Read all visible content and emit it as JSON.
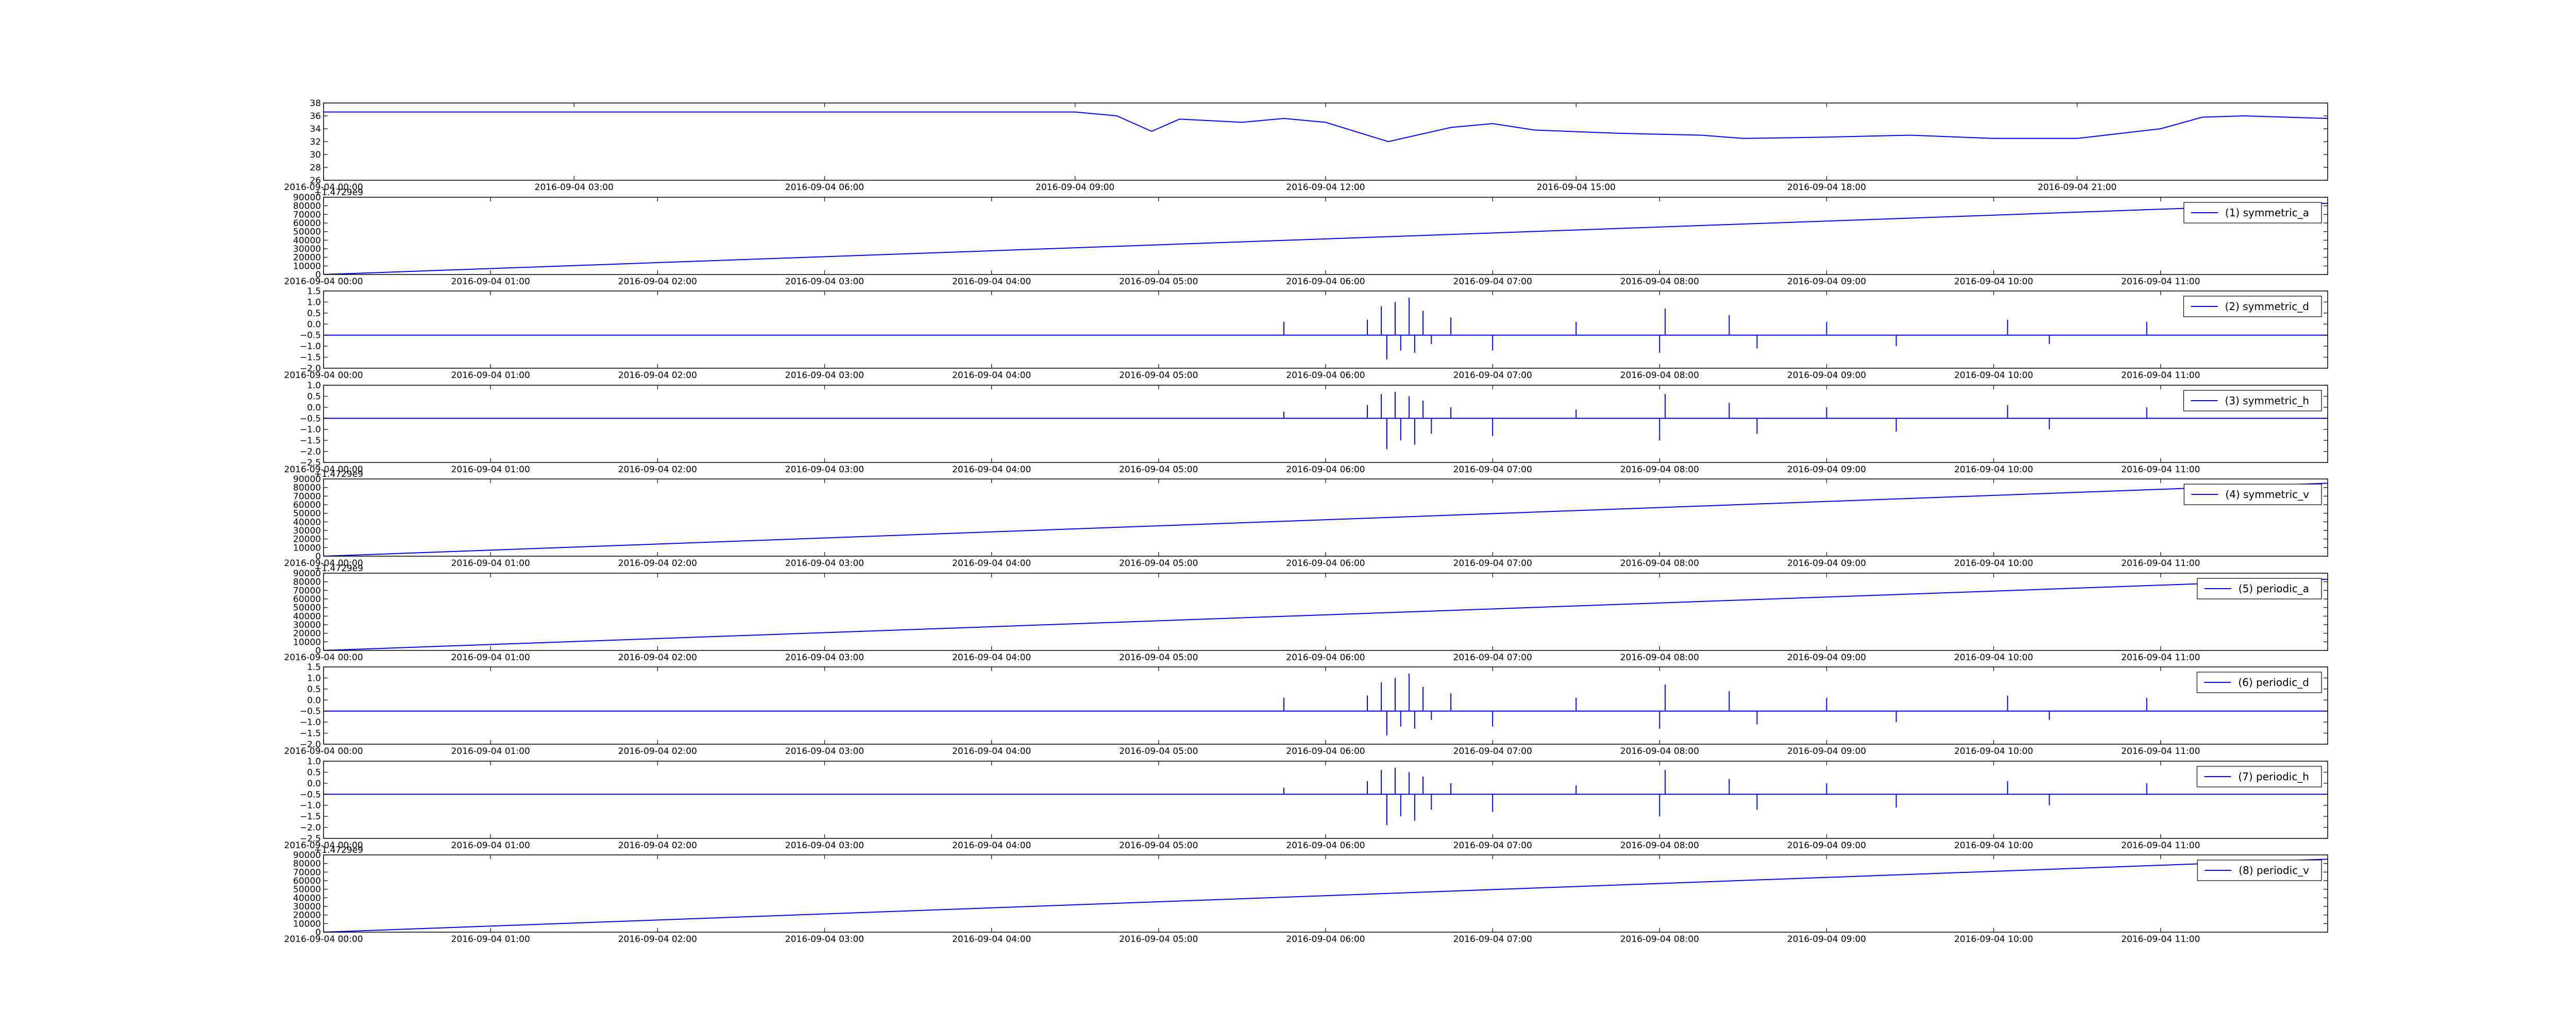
{
  "colors": {
    "line": "#0000ff",
    "axes": "#000000",
    "background": "#ffffff"
  },
  "chart_data": [
    {
      "type": "line",
      "legend": null,
      "legend_position": null,
      "grid": false,
      "x_axis": {
        "type": "datetime",
        "range": [
          "2016-09-04 00:00",
          "2016-09-05 00:00"
        ],
        "ticks": [
          "2016-09-04 00:00",
          "2016-09-04 03:00",
          "2016-09-04 06:00",
          "2016-09-04 09:00",
          "2016-09-04 12:00",
          "2016-09-04 15:00",
          "2016-09-04 18:00",
          "2016-09-04 21:00"
        ]
      },
      "y_axis": {
        "range": [
          26,
          38
        ],
        "ticks": [
          "26",
          "28",
          "30",
          "32",
          "34",
          "36",
          "38"
        ],
        "offset_label": ""
      },
      "series": [
        {
          "points": [
            [
              "2016-09-04 00:00",
              36.6
            ],
            [
              "2016-09-04 09:00",
              36.6
            ],
            [
              "2016-09-04 09:30",
              36.0
            ],
            [
              "2016-09-04 09:55",
              33.6
            ],
            [
              "2016-09-04 10:15",
              35.5
            ],
            [
              "2016-09-04 11:00",
              35.0
            ],
            [
              "2016-09-04 11:30",
              35.6
            ],
            [
              "2016-09-04 12:00",
              35.0
            ],
            [
              "2016-09-04 12:45",
              32.0
            ],
            [
              "2016-09-04 13:30",
              34.2
            ],
            [
              "2016-09-04 14:00",
              34.8
            ],
            [
              "2016-09-04 14:30",
              33.8
            ],
            [
              "2016-09-04 15:30",
              33.3
            ],
            [
              "2016-09-04 16:30",
              33.0
            ],
            [
              "2016-09-04 17:00",
              32.5
            ],
            [
              "2016-09-04 18:00",
              32.7
            ],
            [
              "2016-09-04 19:00",
              33.0
            ],
            [
              "2016-09-04 20:00",
              32.5
            ],
            [
              "2016-09-04 21:00",
              32.5
            ],
            [
              "2016-09-04 22:00",
              34.0
            ],
            [
              "2016-09-04 22:30",
              35.8
            ],
            [
              "2016-09-04 23:00",
              36.0
            ],
            [
              "2016-09-05 00:00",
              35.6
            ]
          ]
        }
      ]
    },
    {
      "type": "line",
      "legend": "(1) symmetric_a",
      "legend_position": "top-right",
      "grid": false,
      "x_axis": {
        "type": "datetime",
        "range": [
          "2016-09-04 00:00",
          "2016-09-04 12:00"
        ],
        "ticks": [
          "2016-09-04 00:00",
          "2016-09-04 01:00",
          "2016-09-04 02:00",
          "2016-09-04 03:00",
          "2016-09-04 04:00",
          "2016-09-04 05:00",
          "2016-09-04 06:00",
          "2016-09-04 07:00",
          "2016-09-04 08:00",
          "2016-09-04 09:00",
          "2016-09-04 10:00",
          "2016-09-04 11:00"
        ]
      },
      "y_axis": {
        "range": [
          0,
          90000
        ],
        "ticks": [
          "0",
          "10000",
          "20000",
          "30000",
          "40000",
          "50000",
          "60000",
          "70000",
          "80000",
          "90000"
        ],
        "offset_label": "+1.4729e9"
      },
      "series": [
        {
          "points": [
            [
              "2016-09-04 00:00",
              0
            ],
            [
              "2016-09-04 12:00",
              83000
            ]
          ]
        }
      ]
    },
    {
      "type": "line",
      "legend": "(2) symmetric_d",
      "legend_position": "top-right",
      "grid": false,
      "x_axis": {
        "type": "datetime",
        "range": [
          "2016-09-04 00:00",
          "2016-09-04 12:00"
        ],
        "ticks": [
          "2016-09-04 00:00",
          "2016-09-04 01:00",
          "2016-09-04 02:00",
          "2016-09-04 03:00",
          "2016-09-04 04:00",
          "2016-09-04 05:00",
          "2016-09-04 06:00",
          "2016-09-04 07:00",
          "2016-09-04 08:00",
          "2016-09-04 09:00",
          "2016-09-04 10:00",
          "2016-09-04 11:00"
        ]
      },
      "y_axis": {
        "range": [
          -2.0,
          1.5
        ],
        "ticks": [
          "−2.0",
          "−1.5",
          "−1.0",
          "−0.5",
          "0.0",
          "0.5",
          "1.0",
          "1.5"
        ],
        "offset_label": ""
      },
      "series": [
        {
          "baseline": -0.5,
          "spikes": [
            [
              "2016-09-04 05:45",
              0.1
            ],
            [
              "2016-09-04 06:15",
              0.2
            ],
            [
              "2016-09-04 06:20",
              0.8
            ],
            [
              "2016-09-04 06:22",
              -1.6
            ],
            [
              "2016-09-04 06:25",
              1.0
            ],
            [
              "2016-09-04 06:27",
              -1.2
            ],
            [
              "2016-09-04 06:30",
              1.2
            ],
            [
              "2016-09-04 06:32",
              -1.3
            ],
            [
              "2016-09-04 06:35",
              0.6
            ],
            [
              "2016-09-04 06:38",
              -0.9
            ],
            [
              "2016-09-04 06:45",
              0.3
            ],
            [
              "2016-09-04 07:00",
              -1.2
            ],
            [
              "2016-09-04 07:30",
              0.1
            ],
            [
              "2016-09-04 08:00",
              -1.3
            ],
            [
              "2016-09-04 08:02",
              0.7
            ],
            [
              "2016-09-04 08:25",
              0.4
            ],
            [
              "2016-09-04 08:35",
              -1.1
            ],
            [
              "2016-09-04 09:00",
              0.1
            ],
            [
              "2016-09-04 09:25",
              -1.0
            ],
            [
              "2016-09-04 10:05",
              0.2
            ],
            [
              "2016-09-04 10:20",
              -0.9
            ],
            [
              "2016-09-04 10:55",
              0.1
            ]
          ]
        }
      ]
    },
    {
      "type": "line",
      "legend": "(3) symmetric_h",
      "legend_position": "top-right",
      "grid": false,
      "x_axis": {
        "type": "datetime",
        "range": [
          "2016-09-04 00:00",
          "2016-09-04 12:00"
        ],
        "ticks": [
          "2016-09-04 00:00",
          "2016-09-04 01:00",
          "2016-09-04 02:00",
          "2016-09-04 03:00",
          "2016-09-04 04:00",
          "2016-09-04 05:00",
          "2016-09-04 06:00",
          "2016-09-04 07:00",
          "2016-09-04 08:00",
          "2016-09-04 09:00",
          "2016-09-04 10:00",
          "2016-09-04 11:00"
        ]
      },
      "y_axis": {
        "range": [
          -2.5,
          1.0
        ],
        "ticks": [
          "−2.5",
          "−2.0",
          "−1.5",
          "−1.0",
          "−0.5",
          "0.0",
          "0.5",
          "1.0"
        ],
        "offset_label": ""
      },
      "series": [
        {
          "baseline": -0.5,
          "spikes": [
            [
              "2016-09-04 05:45",
              -0.2
            ],
            [
              "2016-09-04 06:15",
              0.1
            ],
            [
              "2016-09-04 06:20",
              0.6
            ],
            [
              "2016-09-04 06:22",
              -1.9
            ],
            [
              "2016-09-04 06:25",
              0.7
            ],
            [
              "2016-09-04 06:27",
              -1.5
            ],
            [
              "2016-09-04 06:30",
              0.5
            ],
            [
              "2016-09-04 06:32",
              -1.7
            ],
            [
              "2016-09-04 06:35",
              0.3
            ],
            [
              "2016-09-04 06:38",
              -1.2
            ],
            [
              "2016-09-04 06:45",
              0.0
            ],
            [
              "2016-09-04 07:00",
              -1.3
            ],
            [
              "2016-09-04 07:30",
              -0.1
            ],
            [
              "2016-09-04 08:00",
              -1.5
            ],
            [
              "2016-09-04 08:02",
              0.6
            ],
            [
              "2016-09-04 08:25",
              0.2
            ],
            [
              "2016-09-04 08:35",
              -1.2
            ],
            [
              "2016-09-04 09:00",
              0.0
            ],
            [
              "2016-09-04 09:25",
              -1.1
            ],
            [
              "2016-09-04 10:05",
              0.1
            ],
            [
              "2016-09-04 10:20",
              -1.0
            ],
            [
              "2016-09-04 10:55",
              0.0
            ]
          ]
        }
      ]
    },
    {
      "type": "line",
      "legend": "(4) symmetric_v",
      "legend_position": "top-right",
      "grid": false,
      "x_axis": {
        "type": "datetime",
        "range": [
          "2016-09-04 00:00",
          "2016-09-04 12:00"
        ],
        "ticks": [
          "2016-09-04 00:00",
          "2016-09-04 01:00",
          "2016-09-04 02:00",
          "2016-09-04 03:00",
          "2016-09-04 04:00",
          "2016-09-04 05:00",
          "2016-09-04 06:00",
          "2016-09-04 07:00",
          "2016-09-04 08:00",
          "2016-09-04 09:00",
          "2016-09-04 10:00",
          "2016-09-04 11:00"
        ]
      },
      "y_axis": {
        "range": [
          0,
          90000
        ],
        "ticks": [
          "0",
          "10000",
          "20000",
          "30000",
          "40000",
          "50000",
          "60000",
          "70000",
          "80000",
          "90000"
        ],
        "offset_label": "+1.4729e9"
      },
      "series": [
        {
          "points": [
            [
              "2016-09-04 00:00",
              0
            ],
            [
              "2016-09-04 12:00",
              85000
            ]
          ]
        }
      ]
    },
    {
      "type": "line",
      "legend": "(5) periodic_a",
      "legend_position": "top-right",
      "grid": false,
      "x_axis": {
        "type": "datetime",
        "range": [
          "2016-09-04 00:00",
          "2016-09-04 12:00"
        ],
        "ticks": [
          "2016-09-04 00:00",
          "2016-09-04 01:00",
          "2016-09-04 02:00",
          "2016-09-04 03:00",
          "2016-09-04 04:00",
          "2016-09-04 05:00",
          "2016-09-04 06:00",
          "2016-09-04 07:00",
          "2016-09-04 08:00",
          "2016-09-04 09:00",
          "2016-09-04 10:00",
          "2016-09-04 11:00"
        ]
      },
      "y_axis": {
        "range": [
          0,
          90000
        ],
        "ticks": [
          "0",
          "10000",
          "20000",
          "30000",
          "40000",
          "50000",
          "60000",
          "70000",
          "80000",
          "90000"
        ],
        "offset_label": "+1.4729e9"
      },
      "series": [
        {
          "points": [
            [
              "2016-09-04 00:00",
              0
            ],
            [
              "2016-09-04 12:00",
              83000
            ]
          ]
        }
      ]
    },
    {
      "type": "line",
      "legend": "(6) periodic_d",
      "legend_position": "top-right",
      "grid": false,
      "x_axis": {
        "type": "datetime",
        "range": [
          "2016-09-04 00:00",
          "2016-09-04 12:00"
        ],
        "ticks": [
          "2016-09-04 00:00",
          "2016-09-04 01:00",
          "2016-09-04 02:00",
          "2016-09-04 03:00",
          "2016-09-04 04:00",
          "2016-09-04 05:00",
          "2016-09-04 06:00",
          "2016-09-04 07:00",
          "2016-09-04 08:00",
          "2016-09-04 09:00",
          "2016-09-04 10:00",
          "2016-09-04 11:00"
        ]
      },
      "y_axis": {
        "range": [
          -2.0,
          1.5
        ],
        "ticks": [
          "−2.0",
          "−1.5",
          "−1.0",
          "−0.5",
          "0.0",
          "0.5",
          "1.0",
          "1.5"
        ],
        "offset_label": ""
      },
      "series": [
        {
          "baseline": -0.5,
          "spikes": [
            [
              "2016-09-04 05:45",
              0.1
            ],
            [
              "2016-09-04 06:15",
              0.2
            ],
            [
              "2016-09-04 06:20",
              0.8
            ],
            [
              "2016-09-04 06:22",
              -1.6
            ],
            [
              "2016-09-04 06:25",
              1.0
            ],
            [
              "2016-09-04 06:27",
              -1.2
            ],
            [
              "2016-09-04 06:30",
              1.2
            ],
            [
              "2016-09-04 06:32",
              -1.3
            ],
            [
              "2016-09-04 06:35",
              0.6
            ],
            [
              "2016-09-04 06:38",
              -0.9
            ],
            [
              "2016-09-04 06:45",
              0.3
            ],
            [
              "2016-09-04 07:00",
              -1.2
            ],
            [
              "2016-09-04 07:30",
              0.1
            ],
            [
              "2016-09-04 08:00",
              -1.3
            ],
            [
              "2016-09-04 08:02",
              0.7
            ],
            [
              "2016-09-04 08:25",
              0.4
            ],
            [
              "2016-09-04 08:35",
              -1.1
            ],
            [
              "2016-09-04 09:00",
              0.1
            ],
            [
              "2016-09-04 09:25",
              -1.0
            ],
            [
              "2016-09-04 10:05",
              0.2
            ],
            [
              "2016-09-04 10:20",
              -0.9
            ],
            [
              "2016-09-04 10:55",
              0.1
            ]
          ]
        }
      ]
    },
    {
      "type": "line",
      "legend": "(7) periodic_h",
      "legend_position": "top-right",
      "grid": false,
      "x_axis": {
        "type": "datetime",
        "range": [
          "2016-09-04 00:00",
          "2016-09-04 12:00"
        ],
        "ticks": [
          "2016-09-04 00:00",
          "2016-09-04 01:00",
          "2016-09-04 02:00",
          "2016-09-04 03:00",
          "2016-09-04 04:00",
          "2016-09-04 05:00",
          "2016-09-04 06:00",
          "2016-09-04 07:00",
          "2016-09-04 08:00",
          "2016-09-04 09:00",
          "2016-09-04 10:00",
          "2016-09-04 11:00"
        ]
      },
      "y_axis": {
        "range": [
          -2.5,
          1.0
        ],
        "ticks": [
          "−2.5",
          "−2.0",
          "−1.5",
          "−1.0",
          "−0.5",
          "0.0",
          "0.5",
          "1.0"
        ],
        "offset_label": ""
      },
      "series": [
        {
          "baseline": -0.5,
          "spikes": [
            [
              "2016-09-04 05:45",
              -0.2
            ],
            [
              "2016-09-04 06:15",
              0.1
            ],
            [
              "2016-09-04 06:20",
              0.6
            ],
            [
              "2016-09-04 06:22",
              -1.9
            ],
            [
              "2016-09-04 06:25",
              0.7
            ],
            [
              "2016-09-04 06:27",
              -1.5
            ],
            [
              "2016-09-04 06:30",
              0.5
            ],
            [
              "2016-09-04 06:32",
              -1.7
            ],
            [
              "2016-09-04 06:35",
              0.3
            ],
            [
              "2016-09-04 06:38",
              -1.2
            ],
            [
              "2016-09-04 06:45",
              0.0
            ],
            [
              "2016-09-04 07:00",
              -1.3
            ],
            [
              "2016-09-04 07:30",
              -0.1
            ],
            [
              "2016-09-04 08:00",
              -1.5
            ],
            [
              "2016-09-04 08:02",
              0.6
            ],
            [
              "2016-09-04 08:25",
              0.2
            ],
            [
              "2016-09-04 08:35",
              -1.2
            ],
            [
              "2016-09-04 09:00",
              0.0
            ],
            [
              "2016-09-04 09:25",
              -1.1
            ],
            [
              "2016-09-04 10:05",
              0.1
            ],
            [
              "2016-09-04 10:20",
              -1.0
            ],
            [
              "2016-09-04 10:55",
              0.0
            ]
          ]
        }
      ]
    },
    {
      "type": "line",
      "legend": "(8) periodic_v",
      "legend_position": "top-right",
      "grid": false,
      "x_axis": {
        "type": "datetime",
        "range": [
          "2016-09-04 00:00",
          "2016-09-04 12:00"
        ],
        "ticks": [
          "2016-09-04 00:00",
          "2016-09-04 01:00",
          "2016-09-04 02:00",
          "2016-09-04 03:00",
          "2016-09-04 04:00",
          "2016-09-04 05:00",
          "2016-09-04 06:00",
          "2016-09-04 07:00",
          "2016-09-04 08:00",
          "2016-09-04 09:00",
          "2016-09-04 10:00",
          "2016-09-04 11:00"
        ]
      },
      "y_axis": {
        "range": [
          0,
          90000
        ],
        "ticks": [
          "0",
          "10000",
          "20000",
          "30000",
          "40000",
          "50000",
          "60000",
          "70000",
          "80000",
          "90000"
        ],
        "offset_label": "+1.4729e9"
      },
      "series": [
        {
          "points": [
            [
              "2016-09-04 00:00",
              0
            ],
            [
              "2016-09-04 12:00",
              85000
            ]
          ]
        }
      ]
    }
  ]
}
